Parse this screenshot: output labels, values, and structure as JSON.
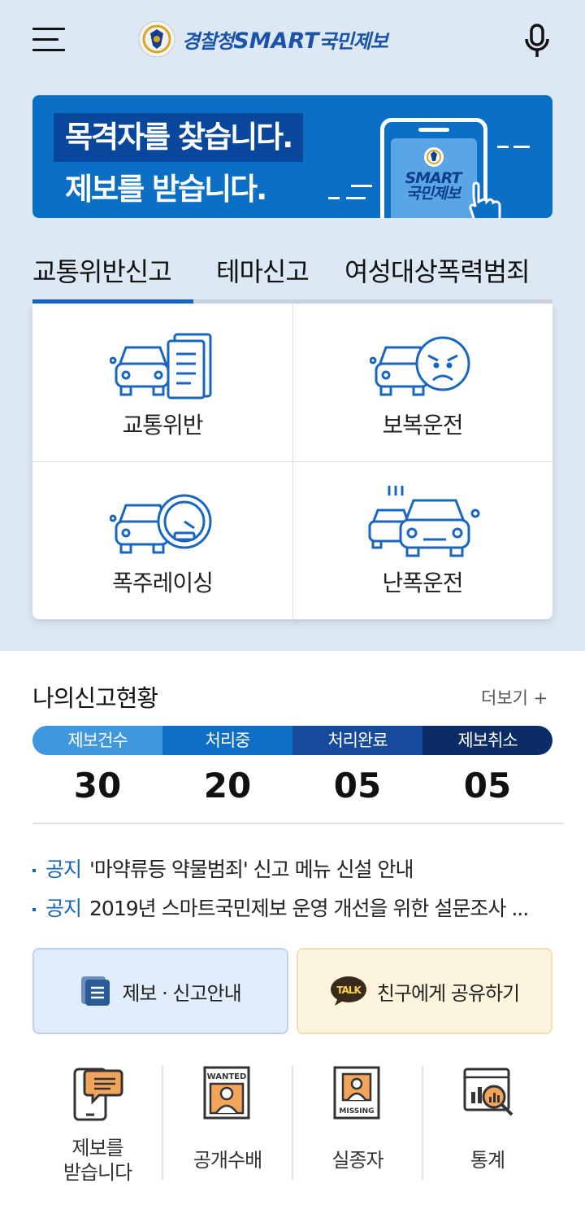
{
  "header": {
    "logo_text_a": "경찰청",
    "logo_text_b": "SMART",
    "logo_text_c": "국민제보",
    "menu_icon": "hamburger-icon",
    "mic_icon": "microphone-icon"
  },
  "banner": {
    "line1": "목격자를 찾습니다.",
    "line2": "제보를 받습니다.",
    "phone_text_1": "SMART",
    "phone_text_2": "국민제보"
  },
  "tabs": [
    {
      "label": "교통위반신고",
      "active": true
    },
    {
      "label": "테마신고",
      "active": false
    },
    {
      "label": "여성대상폭력범죄",
      "active": false
    }
  ],
  "categories": [
    {
      "label": "교통위반",
      "icon": "car-document-icon"
    },
    {
      "label": "보복운전",
      "icon": "car-angry-face-icon"
    },
    {
      "label": "폭주레이싱",
      "icon": "car-speedometer-icon"
    },
    {
      "label": "난폭운전",
      "icon": "car-collision-icon"
    }
  ],
  "status": {
    "title": "나의신고현황",
    "more": "더보기 +",
    "segments": [
      {
        "label": "제보건수",
        "count": "30",
        "color": "#3f97e0"
      },
      {
        "label": "처리중",
        "count": "20",
        "color": "#0f6fc6"
      },
      {
        "label": "처리완료",
        "count": "05",
        "color": "#164a9c"
      },
      {
        "label": "제보취소",
        "count": "05",
        "color": "#0b2c66"
      }
    ]
  },
  "notices": [
    {
      "tag": "공지",
      "text": "'마약류등 약물범죄' 신고 메뉴 신설 안내"
    },
    {
      "tag": "공지",
      "text": "2019년 스마트국민제보 운영 개선을 위한 설문조사 ..."
    }
  ],
  "buttons": {
    "guide": "제보 · 신고안내",
    "share": "친구에게 공유하기",
    "talk_badge": "TALK"
  },
  "bottom_menu": [
    {
      "label_1": "제보를",
      "label_2": "받습니다",
      "icon": "phone-chat-icon"
    },
    {
      "label_1": "공개수배",
      "label_2": "",
      "icon": "wanted-poster-icon",
      "badge": "WANTED"
    },
    {
      "label_1": "실종자",
      "label_2": "",
      "icon": "missing-poster-icon",
      "badge": "MISSING"
    },
    {
      "label_1": "통계",
      "label_2": "",
      "icon": "statistics-magnifier-icon"
    }
  ],
  "colors": {
    "brand_blue": "#1866c2",
    "banner_blue": "#0b6fc6",
    "background_top": "#dce8f4"
  }
}
